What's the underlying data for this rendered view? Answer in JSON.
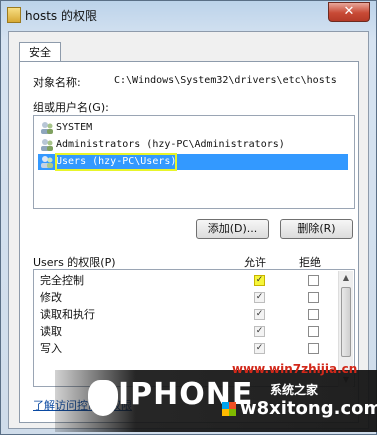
{
  "window": {
    "title": "hosts 的权限",
    "close_symbol": "✕"
  },
  "tabs": [
    {
      "label": "安全"
    }
  ],
  "object": {
    "label": "对象名称:",
    "value": "C:\\Windows\\System32\\drivers\\etc\\hosts"
  },
  "groups": {
    "label": "组或用户名(G):",
    "items": [
      {
        "label": "SYSTEM",
        "selected": false
      },
      {
        "label": "Administrators (hzy-PC\\Administrators)",
        "selected": false
      },
      {
        "label": "Users (hzy-PC\\Users)",
        "selected": true
      }
    ]
  },
  "buttons": {
    "add": "添加(D)...",
    "remove": "删除(R)"
  },
  "permissions": {
    "label": "Users 的权限(P)",
    "col_allow": "允许",
    "col_deny": "拒绝",
    "rows": [
      {
        "name": "完全控制",
        "allow": true,
        "deny": false
      },
      {
        "name": "修改",
        "allow": true,
        "deny": false
      },
      {
        "name": "读取和执行",
        "allow": true,
        "deny": false
      },
      {
        "name": "读取",
        "allow": true,
        "deny": false
      },
      {
        "name": "写入",
        "allow": true,
        "deny": false
      }
    ]
  },
  "link": "了解访问控制和权限",
  "watermark": {
    "site1": "www.win7zhijia.cn",
    "logo": "IPHONE",
    "sub": "系统之家",
    "site2": "w8xitong.com"
  },
  "colors": {
    "selection": "#3399ff",
    "highlight": "#f6f63a"
  }
}
